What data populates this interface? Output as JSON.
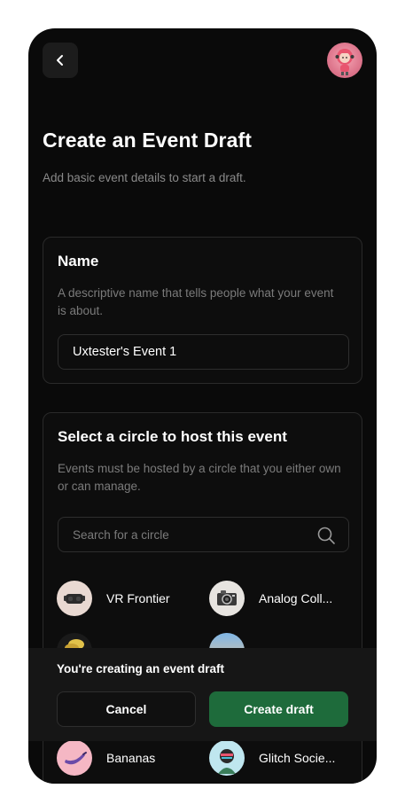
{
  "header": {
    "back_icon": "chevron-left-icon",
    "avatar": "user-avatar"
  },
  "page": {
    "title": "Create an Event Draft",
    "subtitle": "Add basic event details to start a draft."
  },
  "name_section": {
    "heading": "Name",
    "description": "A descriptive name that tells people what your event is about.",
    "value": "Uxtester's Event 1"
  },
  "circle_section": {
    "heading": "Select a circle to host this event",
    "description": "Events must be hosted by a circle that you either own or can manage.",
    "search_placeholder": "Search for a circle",
    "search_icon": "search-icon",
    "circles": [
      {
        "label": "VR Frontier"
      },
      {
        "label": "Analog Coll..."
      },
      {
        "label": ""
      },
      {
        "label": ""
      },
      {
        "label": "Bananas"
      },
      {
        "label": "Glitch Socie..."
      }
    ]
  },
  "draft_bar": {
    "note": "You're creating an event draft",
    "cancel_label": "Cancel",
    "create_label": "Create draft"
  },
  "colors": {
    "background": "#0a0a0a",
    "card_border": "#2a2a2a",
    "muted_text": "#8a8a8a",
    "accent_green": "#1e6b3b"
  }
}
